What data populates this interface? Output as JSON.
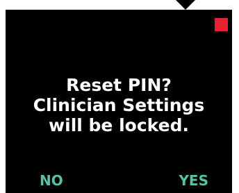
{
  "dialog": {
    "lines": [
      "Reset PIN?",
      "Clinician Settings",
      "will be locked."
    ]
  },
  "softkeys": {
    "left_label": "NO",
    "right_label": "YES"
  },
  "colors": {
    "screen_background": "#000000",
    "message_text": "#ffffff",
    "softkey_text": "#58c2a8",
    "status_indicator": "#e8202f"
  },
  "icons": {
    "status_indicator": "red-square-indicator",
    "pointer": "down-arrow-pointer"
  }
}
